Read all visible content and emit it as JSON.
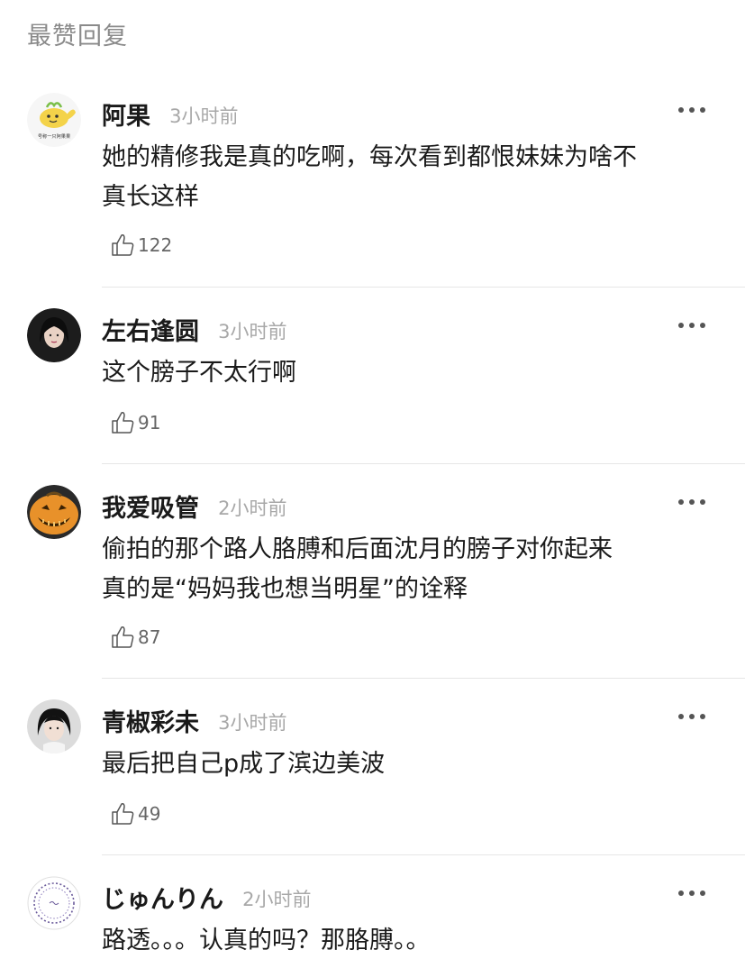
{
  "section": {
    "title": "最赞回复"
  },
  "colors": {
    "text": "#1a1a1a",
    "muted": "#a8a8a8",
    "divider": "#e6e6e6"
  },
  "comments": [
    {
      "username": "阿果",
      "time": "3小时前",
      "lines": [
        "她的精修我是真的吃啊，每次看到都恨妹妹为啥不",
        "真长这样"
      ],
      "likes": "122",
      "avatar_label": "号称一只阿果果",
      "avatar_icon": "banana-whale-avatar"
    },
    {
      "username": "左右逢圆",
      "time": "3小时前",
      "lines": [
        "这个膀子不太行啊"
      ],
      "likes": "91",
      "avatar_icon": "portrait-avatar"
    },
    {
      "username": "我爱吸管",
      "time": "2小时前",
      "lines": [
        "偷拍的那个路人胳膊和后面沈月的膀子对你起来",
        "真的是“妈妈我也想当明星”的诠释"
      ],
      "likes": "87",
      "avatar_icon": "pumpkin-avatar"
    },
    {
      "username": "青椒彩未",
      "time": "3小时前",
      "lines": [
        "最后把自己p成了滨边美波"
      ],
      "likes": "49",
      "avatar_icon": "girl-portrait-avatar"
    },
    {
      "username": "じゅんりん",
      "time": "2小时前",
      "lines": [
        "路透。。。认真的吗？那胳膊。。"
      ],
      "likes": "",
      "avatar_icon": "circular-text-avatar"
    }
  ]
}
